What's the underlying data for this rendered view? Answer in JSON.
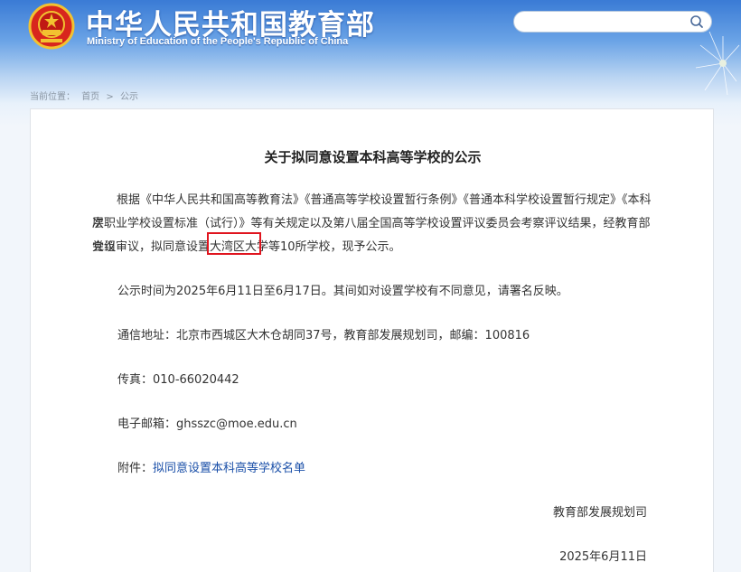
{
  "header": {
    "title_cn": "中华人民共和国教育部",
    "title_en": "Ministry of Education of the People's Republic of China",
    "search": {
      "placeholder": "",
      "value": ""
    }
  },
  "breadcrumb": {
    "prefix": "当前位置：",
    "items": [
      "首页",
      "公示"
    ],
    "separator": ">"
  },
  "article": {
    "title": "关于拟同意设置本科高等学校的公示",
    "paragraph1_line1": "根据《中华人民共和国高等教育法》《普通高等学校设置暂行条例》《普通本科学校设置暂行规定》《本科层",
    "paragraph1_line2": "次职业学校设置标准（试行）》等有关规定以及第八届全国高等学校设置评议委员会考察评议结果，经教育部党组",
    "paragraph1_line3": "会议审议，拟同意设置大湾区大学等10所学校，现予公示。",
    "period": "公示时间为2025年6月11日至6月17日。其间如对设置学校有不同意见，请署名反映。",
    "address": "通信地址：北京市西城区大木仓胡同37号，教育部发展规划司，邮编：100816",
    "fax": "传真：010-66020442",
    "email": "电子邮箱：ghsszc@moe.edu.cn",
    "attachment_label": "附件：",
    "attachment_link": "拟同意设置本科高等学校名单",
    "signer": "教育部发展规划司",
    "date": "2025年6月11日"
  },
  "colors": {
    "highlight": "#e0141e",
    "link": "#1a4fa8",
    "header_blue": "#3a7bd5"
  }
}
